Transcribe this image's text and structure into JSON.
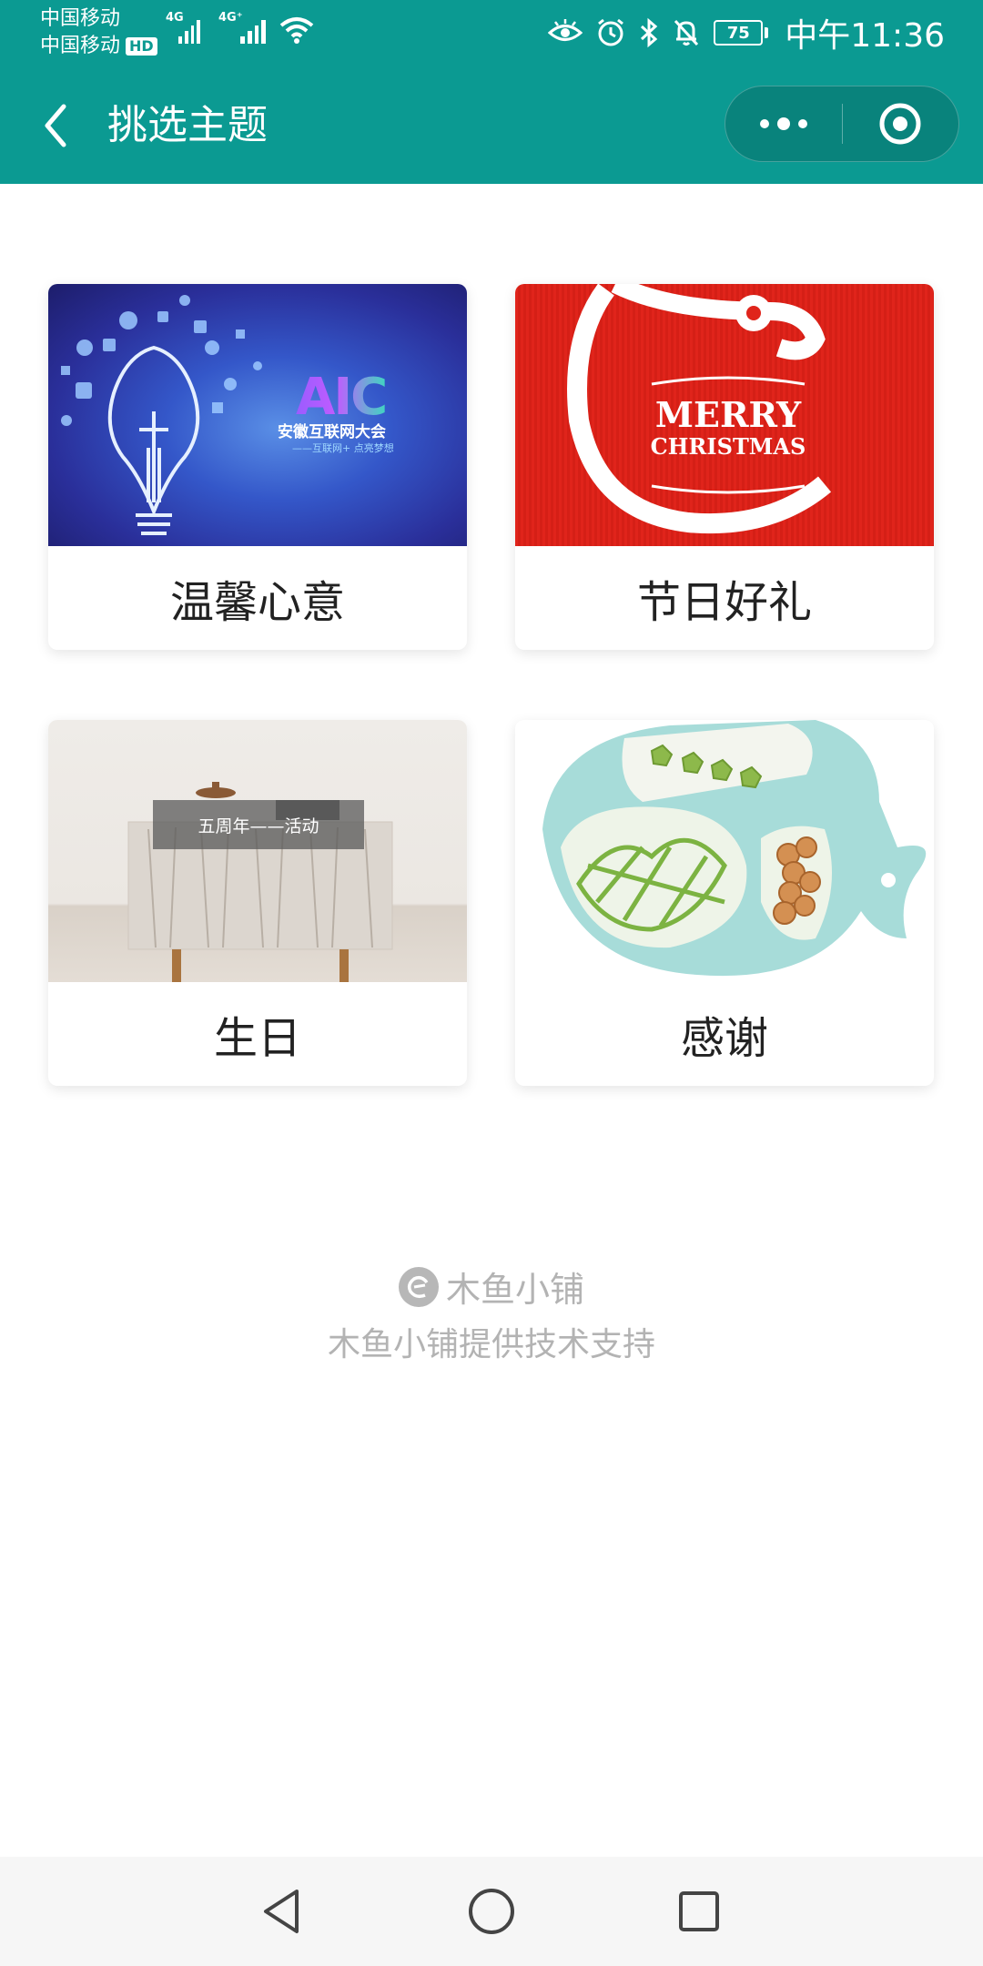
{
  "status_bar": {
    "carrier_1": "中国移动",
    "carrier_2": "中国移动",
    "hd": "HD",
    "net_1": "4G",
    "net_2": "4G⁺",
    "battery": "75",
    "time": "中午11:36"
  },
  "nav": {
    "title": "挑选主题"
  },
  "themes": [
    {
      "label": "温馨心意",
      "image": {
        "logo": "AIC",
        "caption": "安徽互联网大会",
        "slogan": "——互联网+ 点亮梦想"
      }
    },
    {
      "label": "节日好礼",
      "image": {
        "line1": "MERRY",
        "line2": "CHRISTMAS"
      }
    },
    {
      "label": "生日",
      "image": {
        "tag": "五周年——活动"
      }
    },
    {
      "label": "感谢",
      "image": {}
    }
  ],
  "footer": {
    "brand": "木鱼小铺",
    "support": "木鱼小铺提供技术支持"
  },
  "colors": {
    "primary": "#0b9a92",
    "footer_text": "#b3b3b3"
  }
}
